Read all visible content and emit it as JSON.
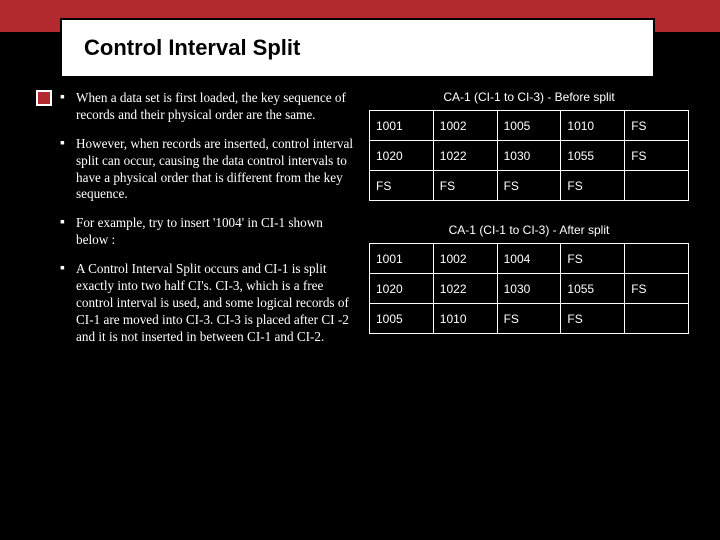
{
  "title": "Control Interval Split",
  "bullets": [
    "When a data set is first loaded, the key sequence of records and their physical order are the same.",
    "However, when records are inserted, control interval split can occur, causing the data control intervals to have a physical order that is different from the key sequence.",
    "For example, try to insert  '1004' in CI-1 shown below  :",
    "A Control Interval Split occurs and CI-1 is split exactly into two half CI's. CI-3, which is a free control interval is used, and some logical records of CI-1 are moved into CI-3. CI-3 is placed after CI -2 and it is not inserted in between CI-1 and CI-2."
  ],
  "tables": {
    "before": {
      "caption": "CA-1 (CI-1 to CI-3) - Before split",
      "rows": [
        [
          "1001",
          "1002",
          "1005",
          "1010",
          "FS"
        ],
        [
          "1020",
          "1022",
          "1030",
          "1055",
          "FS"
        ],
        [
          "FS",
          "FS",
          "FS",
          "FS",
          ""
        ]
      ]
    },
    "after": {
      "caption": "CA-1 (CI-1 to CI-3) - After split",
      "rows": [
        [
          "1001",
          "1002",
          "1004",
          "FS",
          ""
        ],
        [
          "1020",
          "1022",
          "1030",
          "1055",
          "FS"
        ],
        [
          "1005",
          "1010",
          "FS",
          "FS",
          ""
        ]
      ]
    }
  }
}
